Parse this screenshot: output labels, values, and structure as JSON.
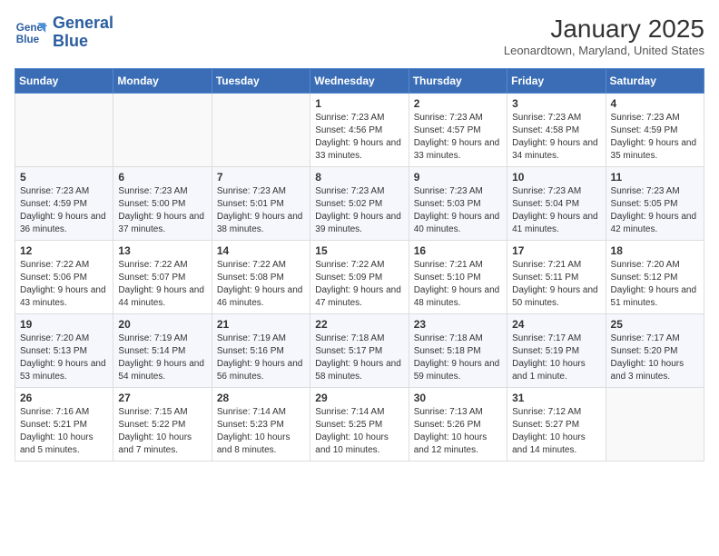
{
  "logo": {
    "name_line1": "General",
    "name_line2": "Blue"
  },
  "header": {
    "month": "January 2025",
    "location": "Leonardtown, Maryland, United States"
  },
  "weekdays": [
    "Sunday",
    "Monday",
    "Tuesday",
    "Wednesday",
    "Thursday",
    "Friday",
    "Saturday"
  ],
  "weeks": [
    [
      {
        "day": "",
        "sunrise": "",
        "sunset": "",
        "daylight": ""
      },
      {
        "day": "",
        "sunrise": "",
        "sunset": "",
        "daylight": ""
      },
      {
        "day": "",
        "sunrise": "",
        "sunset": "",
        "daylight": ""
      },
      {
        "day": "1",
        "sunrise": "Sunrise: 7:23 AM",
        "sunset": "Sunset: 4:56 PM",
        "daylight": "Daylight: 9 hours and 33 minutes."
      },
      {
        "day": "2",
        "sunrise": "Sunrise: 7:23 AM",
        "sunset": "Sunset: 4:57 PM",
        "daylight": "Daylight: 9 hours and 33 minutes."
      },
      {
        "day": "3",
        "sunrise": "Sunrise: 7:23 AM",
        "sunset": "Sunset: 4:58 PM",
        "daylight": "Daylight: 9 hours and 34 minutes."
      },
      {
        "day": "4",
        "sunrise": "Sunrise: 7:23 AM",
        "sunset": "Sunset: 4:59 PM",
        "daylight": "Daylight: 9 hours and 35 minutes."
      }
    ],
    [
      {
        "day": "5",
        "sunrise": "Sunrise: 7:23 AM",
        "sunset": "Sunset: 4:59 PM",
        "daylight": "Daylight: 9 hours and 36 minutes."
      },
      {
        "day": "6",
        "sunrise": "Sunrise: 7:23 AM",
        "sunset": "Sunset: 5:00 PM",
        "daylight": "Daylight: 9 hours and 37 minutes."
      },
      {
        "day": "7",
        "sunrise": "Sunrise: 7:23 AM",
        "sunset": "Sunset: 5:01 PM",
        "daylight": "Daylight: 9 hours and 38 minutes."
      },
      {
        "day": "8",
        "sunrise": "Sunrise: 7:23 AM",
        "sunset": "Sunset: 5:02 PM",
        "daylight": "Daylight: 9 hours and 39 minutes."
      },
      {
        "day": "9",
        "sunrise": "Sunrise: 7:23 AM",
        "sunset": "Sunset: 5:03 PM",
        "daylight": "Daylight: 9 hours and 40 minutes."
      },
      {
        "day": "10",
        "sunrise": "Sunrise: 7:23 AM",
        "sunset": "Sunset: 5:04 PM",
        "daylight": "Daylight: 9 hours and 41 minutes."
      },
      {
        "day": "11",
        "sunrise": "Sunrise: 7:23 AM",
        "sunset": "Sunset: 5:05 PM",
        "daylight": "Daylight: 9 hours and 42 minutes."
      }
    ],
    [
      {
        "day": "12",
        "sunrise": "Sunrise: 7:22 AM",
        "sunset": "Sunset: 5:06 PM",
        "daylight": "Daylight: 9 hours and 43 minutes."
      },
      {
        "day": "13",
        "sunrise": "Sunrise: 7:22 AM",
        "sunset": "Sunset: 5:07 PM",
        "daylight": "Daylight: 9 hours and 44 minutes."
      },
      {
        "day": "14",
        "sunrise": "Sunrise: 7:22 AM",
        "sunset": "Sunset: 5:08 PM",
        "daylight": "Daylight: 9 hours and 46 minutes."
      },
      {
        "day": "15",
        "sunrise": "Sunrise: 7:22 AM",
        "sunset": "Sunset: 5:09 PM",
        "daylight": "Daylight: 9 hours and 47 minutes."
      },
      {
        "day": "16",
        "sunrise": "Sunrise: 7:21 AM",
        "sunset": "Sunset: 5:10 PM",
        "daylight": "Daylight: 9 hours and 48 minutes."
      },
      {
        "day": "17",
        "sunrise": "Sunrise: 7:21 AM",
        "sunset": "Sunset: 5:11 PM",
        "daylight": "Daylight: 9 hours and 50 minutes."
      },
      {
        "day": "18",
        "sunrise": "Sunrise: 7:20 AM",
        "sunset": "Sunset: 5:12 PM",
        "daylight": "Daylight: 9 hours and 51 minutes."
      }
    ],
    [
      {
        "day": "19",
        "sunrise": "Sunrise: 7:20 AM",
        "sunset": "Sunset: 5:13 PM",
        "daylight": "Daylight: 9 hours and 53 minutes."
      },
      {
        "day": "20",
        "sunrise": "Sunrise: 7:19 AM",
        "sunset": "Sunset: 5:14 PM",
        "daylight": "Daylight: 9 hours and 54 minutes."
      },
      {
        "day": "21",
        "sunrise": "Sunrise: 7:19 AM",
        "sunset": "Sunset: 5:16 PM",
        "daylight": "Daylight: 9 hours and 56 minutes."
      },
      {
        "day": "22",
        "sunrise": "Sunrise: 7:18 AM",
        "sunset": "Sunset: 5:17 PM",
        "daylight": "Daylight: 9 hours and 58 minutes."
      },
      {
        "day": "23",
        "sunrise": "Sunrise: 7:18 AM",
        "sunset": "Sunset: 5:18 PM",
        "daylight": "Daylight: 9 hours and 59 minutes."
      },
      {
        "day": "24",
        "sunrise": "Sunrise: 7:17 AM",
        "sunset": "Sunset: 5:19 PM",
        "daylight": "Daylight: 10 hours and 1 minute."
      },
      {
        "day": "25",
        "sunrise": "Sunrise: 7:17 AM",
        "sunset": "Sunset: 5:20 PM",
        "daylight": "Daylight: 10 hours and 3 minutes."
      }
    ],
    [
      {
        "day": "26",
        "sunrise": "Sunrise: 7:16 AM",
        "sunset": "Sunset: 5:21 PM",
        "daylight": "Daylight: 10 hours and 5 minutes."
      },
      {
        "day": "27",
        "sunrise": "Sunrise: 7:15 AM",
        "sunset": "Sunset: 5:22 PM",
        "daylight": "Daylight: 10 hours and 7 minutes."
      },
      {
        "day": "28",
        "sunrise": "Sunrise: 7:14 AM",
        "sunset": "Sunset: 5:23 PM",
        "daylight": "Daylight: 10 hours and 8 minutes."
      },
      {
        "day": "29",
        "sunrise": "Sunrise: 7:14 AM",
        "sunset": "Sunset: 5:25 PM",
        "daylight": "Daylight: 10 hours and 10 minutes."
      },
      {
        "day": "30",
        "sunrise": "Sunrise: 7:13 AM",
        "sunset": "Sunset: 5:26 PM",
        "daylight": "Daylight: 10 hours and 12 minutes."
      },
      {
        "day": "31",
        "sunrise": "Sunrise: 7:12 AM",
        "sunset": "Sunset: 5:27 PM",
        "daylight": "Daylight: 10 hours and 14 minutes."
      },
      {
        "day": "",
        "sunrise": "",
        "sunset": "",
        "daylight": ""
      }
    ]
  ]
}
